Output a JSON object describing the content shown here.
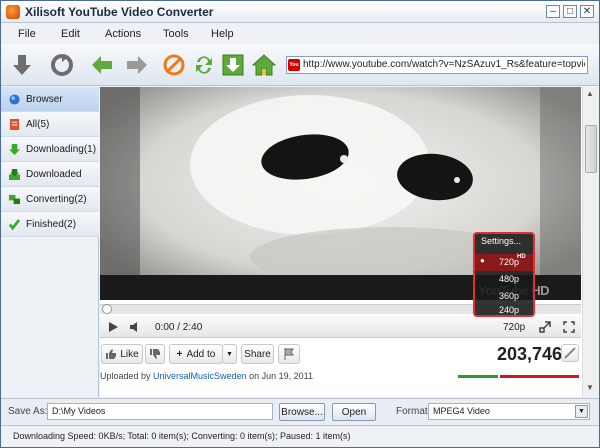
{
  "window": {
    "title": "Xilisoft YouTube Video Converter"
  },
  "menu": [
    "File",
    "Edit",
    "Actions",
    "Tools",
    "Help"
  ],
  "toolbar": {
    "url_value": "http://www.youtube.com/watch?v=NzSAzuv1_Rs&feature=topvideos_mus",
    "yt_badge": "You"
  },
  "sidebar": {
    "items": [
      {
        "label": "Browser"
      },
      {
        "label": "All(5)"
      },
      {
        "label": "Downloading(1)"
      },
      {
        "label": "Downloaded"
      },
      {
        "label": "Converting(2)"
      },
      {
        "label": "Finished(2)"
      }
    ]
  },
  "player": {
    "watermark": "YouTube HD",
    "time": "0:00 / 2:40",
    "quality": "720p",
    "settings": {
      "title": "Settings...",
      "options": [
        "720p",
        "480p",
        "360p",
        "240p"
      ],
      "selected": "720p",
      "hd_tag": "HD"
    }
  },
  "actions": {
    "like": "Like",
    "add_to": "Add to",
    "share": "Share"
  },
  "views": "203,746",
  "upload": {
    "prefix": "Uploaded by ",
    "user": "UniversalMusicSweden",
    "suffix": " on Jun 19, 2011"
  },
  "save": {
    "label": "Save As:",
    "path": "D:\\My Videos",
    "browse": "Browse...",
    "open": "Open",
    "format_label": "Format:",
    "format_value": "MPEG4 Video"
  },
  "status": {
    "text": "Downloading Speed: 0KB/s; Total: 0 item(s); Converting: 0 item(s); Paused: 1 item(s)"
  }
}
